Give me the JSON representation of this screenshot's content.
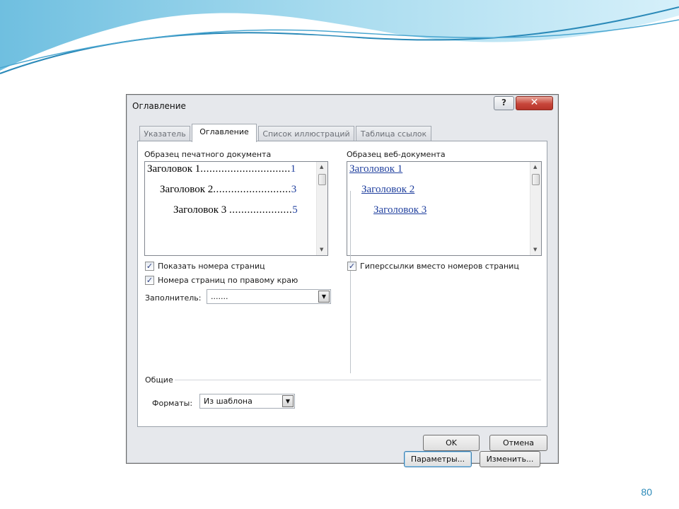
{
  "dialog": {
    "title": "Оглавление",
    "help_label": "?",
    "close_label": "✕"
  },
  "tabs": [
    {
      "label": "Указатель",
      "active": false
    },
    {
      "label": "Оглавление",
      "active": true
    },
    {
      "label": "Список иллюстраций",
      "active": false
    },
    {
      "label": "Таблица ссылок",
      "active": false
    }
  ],
  "print_preview": {
    "label": "Образец печатного документа",
    "entries": [
      {
        "heading": "Заголовок 1",
        "leader": "..............................",
        "page": "1"
      },
      {
        "heading": "Заголовок 2",
        "leader": "..........................",
        "page": "3"
      },
      {
        "heading": "Заголовок 3",
        "leader": ".....................",
        "page": "5"
      }
    ]
  },
  "web_preview": {
    "label": "Образец веб-документа",
    "entries": [
      "Заголовок 1",
      "Заголовок 2",
      "Заголовок 3"
    ]
  },
  "options": {
    "show_page_numbers": {
      "label": "Показать номера страниц",
      "checked": true
    },
    "right_align": {
      "label": "Номера страниц по правому краю",
      "checked": true
    },
    "hyperlinks": {
      "label": "Гиперссылки вместо номеров страниц",
      "checked": true
    },
    "filler_label": "Заполнитель:",
    "filler_value": "......."
  },
  "general": {
    "group_label": "Общие",
    "formats_label": "Форматы:",
    "formats_value": "Из шаблона"
  },
  "buttons": {
    "options": "Параметры...",
    "modify": "Изменить...",
    "ok": "OK",
    "cancel": "Отмена"
  },
  "slide": {
    "number": "80"
  },
  "colors": {
    "page_number_accent": "#1f3f9e",
    "slide_number": "#2a89b8",
    "close_button": "#c7463a"
  }
}
